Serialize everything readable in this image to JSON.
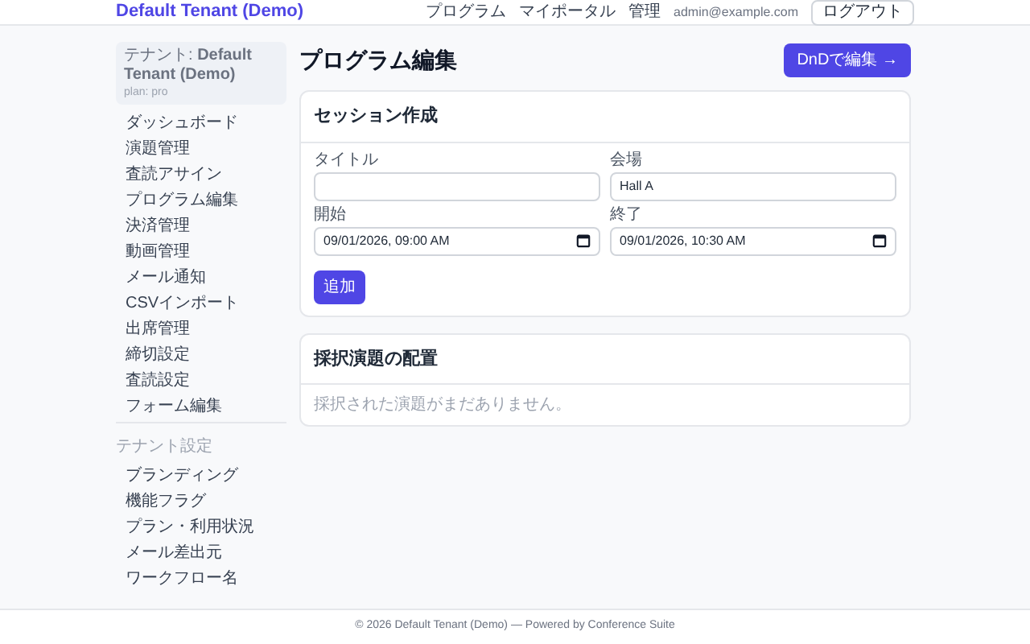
{
  "header": {
    "brand": "Default Tenant (Demo)",
    "nav": [
      "プログラム",
      "マイポータル",
      "管理"
    ],
    "user": "admin@example.com",
    "logout": "ログアウト"
  },
  "sidebar": {
    "tenant": "テナント: **Default Tenant (Demo)**",
    "plan": "plan: pro",
    "items": [
      {
        "label": "ダッシュボード",
        "kind": "link"
      },
      {
        "label": "演題管理",
        "kind": "link"
      },
      {
        "label": "査読アサイン",
        "kind": "link"
      },
      {
        "label": "プログラム編集",
        "kind": "link"
      },
      {
        "label": "決済管理",
        "kind": "link"
      },
      {
        "label": "動画管理",
        "kind": "link"
      },
      {
        "label": "メール通知",
        "kind": "link"
      },
      {
        "label": "CSVインポート",
        "kind": "link"
      },
      {
        "label": "出席管理",
        "kind": "link"
      },
      {
        "label": "締切設定",
        "kind": "link"
      },
      {
        "label": "査読設定",
        "kind": "link"
      },
      {
        "label": "フォーム編集",
        "kind": "link"
      },
      {
        "label": "テナント設定",
        "kind": "section"
      },
      {
        "label": "ブランディング",
        "kind": "link"
      },
      {
        "label": "機能フラグ",
        "kind": "link"
      },
      {
        "label": "プラン・利用状況",
        "kind": "link"
      },
      {
        "label": "メール差出元",
        "kind": "link"
      },
      {
        "label": "ワークフロー名",
        "kind": "link"
      }
    ]
  },
  "page": {
    "title": "プログラム編集",
    "dnd_button": "DnDで編集 →"
  },
  "session_card": {
    "title": "セッション作成",
    "fields": [
      {
        "label": "タイトル",
        "kind": "text"
      },
      {
        "label": "会場",
        "value": "Hall A",
        "kind": "text"
      },
      {
        "label": "開始",
        "value": "09/01/2026, 09:00 AM",
        "kind": "datetime"
      },
      {
        "label": "終了",
        "value": "09/01/2026, 10:30 AM",
        "kind": "datetime"
      }
    ],
    "add_button": "追加"
  },
  "placement_card": {
    "title": "採択演題の配置",
    "empty": "採択された演題がまだありません。"
  },
  "footer": "© 2026 Default Tenant (Demo) — Powered by Conference Suite"
}
